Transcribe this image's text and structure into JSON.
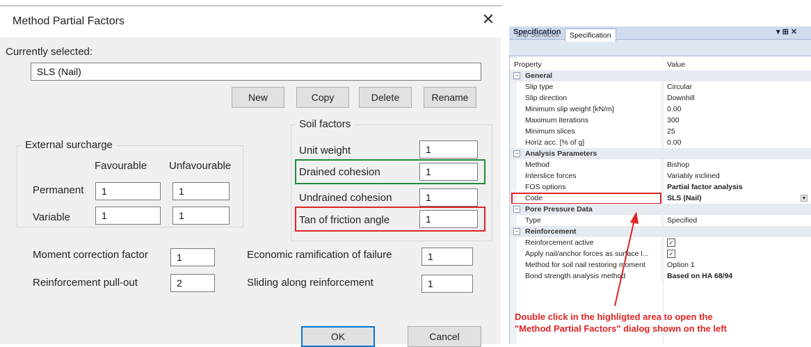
{
  "dialog": {
    "title": "Method Partial Factors",
    "close_glyph": "✕",
    "currently_selected_label": "Currently selected:",
    "currently_selected_value": "SLS (Nail)",
    "buttons": {
      "new": "New",
      "copy": "Copy",
      "delete": "Delete",
      "rename": "Rename",
      "ok": "OK",
      "cancel": "Cancel"
    },
    "external_surcharge": {
      "title": "External surcharge",
      "col_favourable": "Favourable",
      "col_unfavourable": "Unfavourable",
      "permanent_label": "Permanent",
      "variable_label": "Variable",
      "permanent_fav": "1",
      "permanent_unfav": "1",
      "variable_fav": "1",
      "variable_unfav": "1"
    },
    "soil_factors": {
      "title": "Soil factors",
      "unit_weight_label": "Unit weight",
      "unit_weight": "1",
      "drained_cohesion_label": "Drained cohesion",
      "drained_cohesion": "1",
      "undrained_cohesion_label": "Undrained cohesion",
      "undrained_cohesion": "1",
      "tan_friction_label": "Tan of friction angle",
      "tan_friction": "1"
    },
    "moment_correction_label": "Moment correction factor",
    "moment_correction": "1",
    "reinforcement_pullout_label": "Reinforcement pull-out",
    "reinforcement_pullout": "2",
    "economic_ramification_label": "Economic ramification of failure",
    "economic_ramification": "1",
    "sliding_reinforcement_label": "Sliding along reinforcement",
    "sliding_reinforcement": "1"
  },
  "panel": {
    "title": "Specification",
    "controls": "▾ ⊞ ✕",
    "tabs": [
      "Slip Surfaces",
      "Specification"
    ],
    "header": {
      "property": "Property",
      "value": "Value"
    },
    "general": {
      "title": "General",
      "slip_type": [
        "Slip type",
        "Circular"
      ],
      "slip_direction": [
        "Slip direction",
        "Downhill"
      ],
      "min_slip_weight": [
        "Minimum slip weight [kN/m]",
        "0.00"
      ],
      "max_iterations": [
        "Maximum iterations",
        "300"
      ],
      "min_slices": [
        "Minimum slices",
        "25"
      ],
      "horiz_acc": [
        "Horiz acc. [% of g]",
        "0.00"
      ]
    },
    "analysis": {
      "title": "Analysis Parameters",
      "method": [
        "Method",
        "Bishop"
      ],
      "interslice": [
        "Interslice forces",
        "Variably inclined"
      ],
      "fos": [
        "FOS options",
        "Partial factor analysis"
      ],
      "code": [
        "Code",
        "SLS (Nail)"
      ]
    },
    "pore": {
      "title": "Pore Pressure Data",
      "type": [
        "Type",
        "Specified"
      ]
    },
    "reinforcement": {
      "title": "Reinforcement",
      "active": "Reinforcement active",
      "apply": "Apply nail/anchor forces as surface l...",
      "method": [
        "Method for soil nail restoring moment",
        "Option 1"
      ],
      "bond": [
        "Bond strength analysis method",
        "Based on HA 68/94"
      ]
    },
    "annotation_line1": "Double click in the highligted area to open the",
    "annotation_line2": "\"Method Partial Factors\" dialog shown on the left"
  },
  "colors": {
    "accent_blue": "#0078d7",
    "highlight_green": "#1f8a3b",
    "highlight_red": "#e02424"
  }
}
